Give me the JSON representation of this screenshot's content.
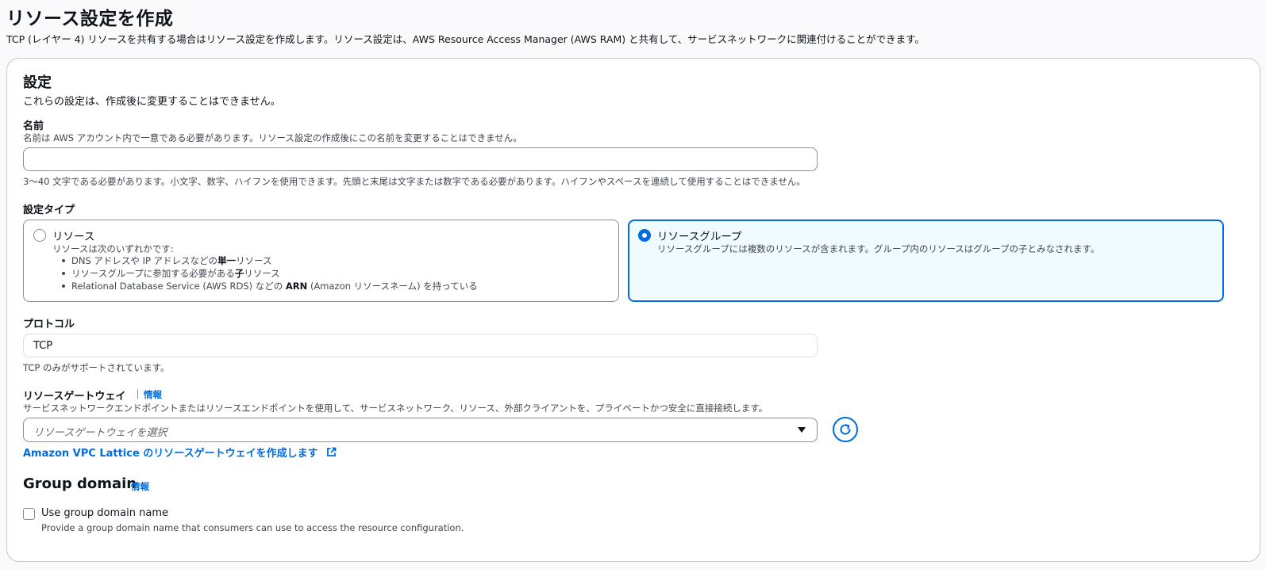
{
  "page": {
    "title": "リソース設定を作成",
    "description": "TCP (レイヤー 4) リソースを共有する場合はリソース設定を作成します。リソース設定は、AWS Resource Access Manager (AWS RAM) と共有して、サービスネットワークに関連付けることができます。"
  },
  "settings": {
    "heading": "設定",
    "description": "これらの設定は、作成後に変更することはできません。",
    "name": {
      "label": "名前",
      "description": "名前は AWS アカウント内で一意である必要があります。リソース設定の作成後にこの名前を変更することはできません。",
      "value": "",
      "constraint": "3〜40 文字である必要があります。小文字、数字、ハイフンを使用できます。先頭と末尾は文字または数字である必要があります。ハイフンやスペースを連続して使用することはできません。"
    },
    "config_type": {
      "label": "設定タイプ",
      "options": [
        {
          "title": "リソース",
          "description": "リソースは次のいずれかです:",
          "bullets": [
            {
              "pre": "DNS アドレスや IP アドレスなどの",
              "strong": "単一",
              "post": "リソース"
            },
            {
              "pre": "リソースグループに参加する必要がある",
              "strong": "子",
              "post": "リソース"
            },
            {
              "pre": "Relational Database Service (AWS RDS) などの ",
              "strong": "ARN",
              "post": " (Amazon リソースネーム) を持っている"
            }
          ],
          "selected": false
        },
        {
          "title": "リソースグループ",
          "description": "リソースグループには複数のリソースが含まれます。グループ内のリソースはグループの子とみなされます。",
          "selected": true
        }
      ]
    },
    "protocol": {
      "label": "プロトコル",
      "value": "TCP",
      "constraint": "TCP のみがサポートされています。"
    },
    "gateway": {
      "label": "リソースゲートウェイ",
      "info": "情報",
      "description": "サービスネットワークエンドポイントまたはリソースエンドポイントを使用して、サービスネットワーク、リソース、外部クライアントを、プライベートかつ安全に直接接続します。",
      "placeholder": "リソースゲートウェイを選択",
      "create_link": "Amazon VPC Lattice のリソースゲートウェイを作成します"
    },
    "group_domain": {
      "heading": "Group domain",
      "info": "情報",
      "checkbox_label": "Use group domain name",
      "checkbox_description": "Provide a group domain name that consumers can use to access the resource configuration.",
      "checked": false
    }
  },
  "colors": {
    "accent": "#006ce0",
    "selected_tile_bg": "#f0fbff",
    "border": "#8c8c94"
  }
}
